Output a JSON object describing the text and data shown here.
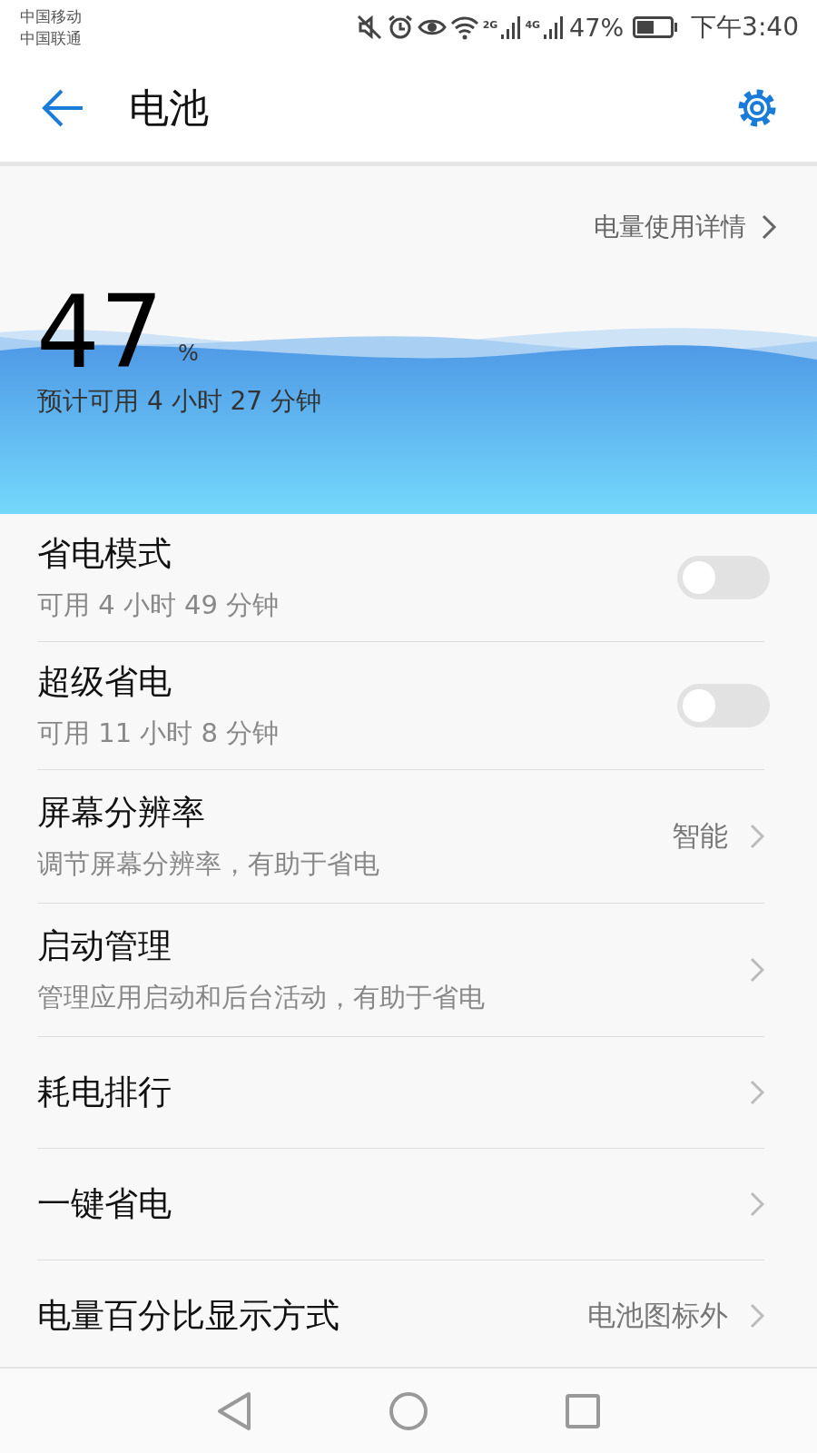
{
  "status_bar": {
    "carriers": [
      "中国移动",
      "中国联通"
    ],
    "network_labels": [
      "2G",
      "4G"
    ],
    "battery": "47%",
    "time": "下午3:40"
  },
  "header": {
    "title": "电池"
  },
  "battery": {
    "details_link": "电量使用详情",
    "percent": "47",
    "percent_unit": "%",
    "estimate": "预计可用 4 小时 27 分钟"
  },
  "settings": [
    {
      "kind": "toggle",
      "title": "省电模式",
      "subtitle": "可用 4 小时 49 分钟",
      "on": false
    },
    {
      "kind": "toggle",
      "title": "超级省电",
      "subtitle": "可用 11 小时 8 分钟",
      "on": false
    },
    {
      "kind": "link",
      "title": "屏幕分辨率",
      "subtitle": "调节屏幕分辨率，有助于省电",
      "value": "智能"
    },
    {
      "kind": "link",
      "title": "启动管理",
      "subtitle": "管理应用启动和后台活动，有助于省电"
    },
    {
      "kind": "link",
      "title": "耗电排行"
    },
    {
      "kind": "link",
      "title": "一键省电"
    },
    {
      "kind": "link",
      "title": "电量百分比显示方式",
      "value": "电池图标外"
    }
  ]
}
